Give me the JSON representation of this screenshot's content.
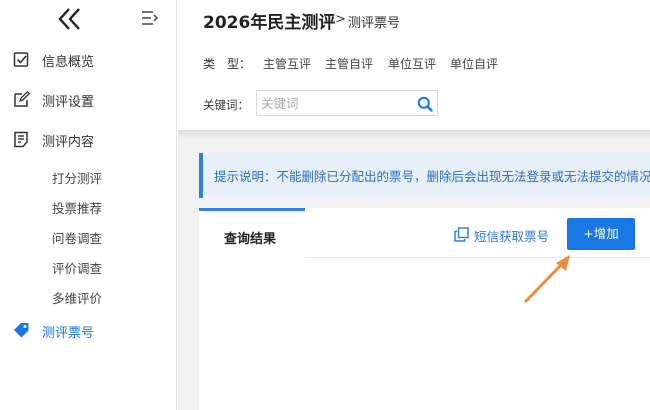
{
  "sidebar": {
    "items": [
      {
        "label": "信息概览",
        "icon": "checkbox-icon"
      },
      {
        "label": "测评设置",
        "icon": "edit-icon"
      },
      {
        "label": "测评内容",
        "icon": "list-doc-icon"
      }
    ],
    "subitems": [
      "打分测评",
      "投票推荐",
      "问卷调查",
      "评价调查",
      "多维评价"
    ],
    "active": {
      "label": "测评票号",
      "icon": "tag-icon"
    }
  },
  "header": {
    "title": "2026年民主测评",
    "separator": ">",
    "subtitle": "测评票号",
    "type_label": "类　型：",
    "type_options": [
      "主管互评",
      "主管自评",
      "单位互评",
      "单位自评"
    ],
    "keyword_label": "关键词：",
    "keyword_placeholder": "关键词",
    "keyword_value": ""
  },
  "notice": {
    "text": "提示说明：不能删除已分配出的票号，删除后会出现无法登录或无法提交的情况"
  },
  "panel": {
    "tab_label": "查询结果",
    "sms_label": "短信获取票号",
    "add_label": "+增加"
  },
  "colors": {
    "accent": "#1677e5",
    "notice_bg": "#e8f0fb",
    "arrow": "#f08a3c"
  }
}
